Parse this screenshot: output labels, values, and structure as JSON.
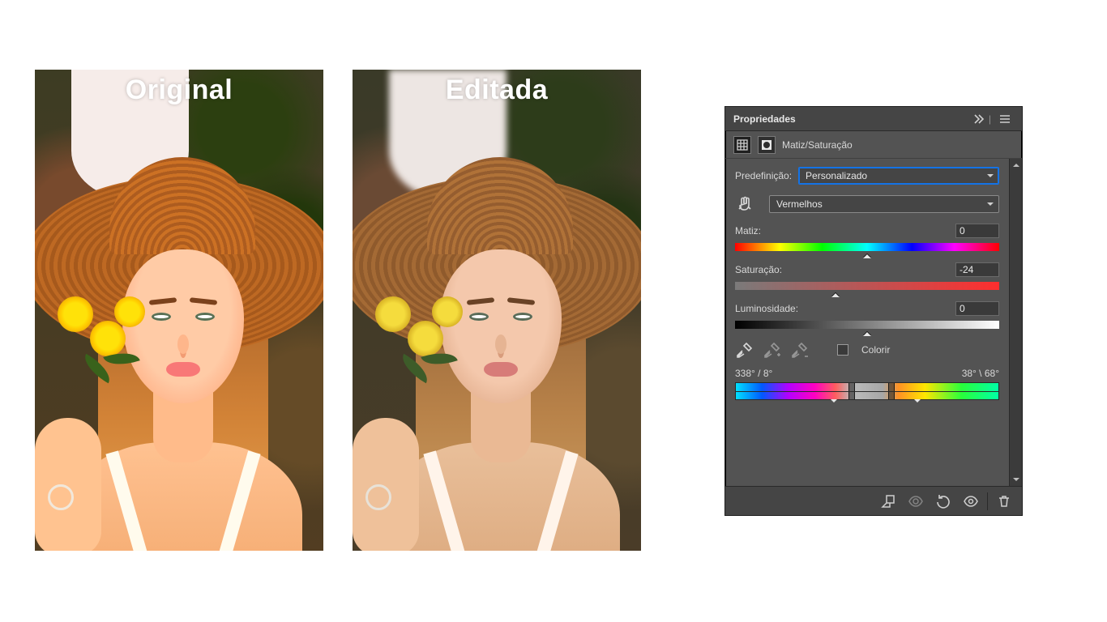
{
  "comparison": {
    "original_label": "Original",
    "edited_label": "Editada"
  },
  "panel": {
    "title": "Propriedades",
    "header_icons": {
      "collapse": "chevrons-right-icon",
      "menu": "menu-icon"
    },
    "adjustment": {
      "presets_icon": "presets-icon",
      "mask_icon": "layer-mask-icon",
      "name": "Matiz/Saturação"
    },
    "preset": {
      "label": "Predefinição:",
      "value": "Personalizado"
    },
    "channel": {
      "scrubby_icon": "scrubby-hand-icon",
      "value": "Vermelhos"
    },
    "sliders": {
      "hue": {
        "label": "Matiz:",
        "value": "0",
        "pos_pct": 50
      },
      "saturation": {
        "label": "Saturação:",
        "value": "-24",
        "pos_pct": 38
      },
      "lightness": {
        "label": "Luminosidade:",
        "value": "0",
        "pos_pct": 50
      }
    },
    "eyedroppers": {
      "base": "eyedropper-icon",
      "add": "eyedropper-plus-icon",
      "sub": "eyedropper-minus-icon"
    },
    "colorize": {
      "label": "Colorir",
      "checked": false
    },
    "range": {
      "left": "338° / 8°",
      "right": "38° \\ 68°",
      "outer_left_pct": 36,
      "inner_left_pct": 43,
      "inner_right_pct": 58,
      "outer_right_pct": 68
    },
    "footer_icons": {
      "clip": "clip-to-layer-icon",
      "view": "view-previous-icon",
      "reset": "reset-icon",
      "visibility": "visibility-icon",
      "delete": "trash-icon"
    }
  }
}
